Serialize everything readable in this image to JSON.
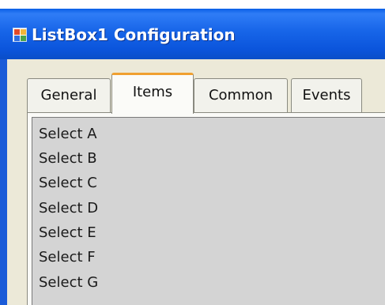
{
  "window": {
    "title": "ListBox1 Configuration",
    "icon": "listbox-app-icon"
  },
  "tabs": [
    {
      "label": "General",
      "selected": false
    },
    {
      "label": "Items",
      "selected": true
    },
    {
      "label": "Common",
      "selected": false
    },
    {
      "label": "Events",
      "selected": false
    }
  ],
  "listbox": {
    "items": [
      "Select A",
      "Select B",
      "Select C",
      "Select D",
      "Select E",
      "Select F",
      "Select G"
    ]
  },
  "colors": {
    "titlebar": "#0b55dc",
    "dialog_background": "#ece9d8",
    "selected_tab_accent": "#f0a030",
    "listbox_background": "#d4d4d4"
  }
}
